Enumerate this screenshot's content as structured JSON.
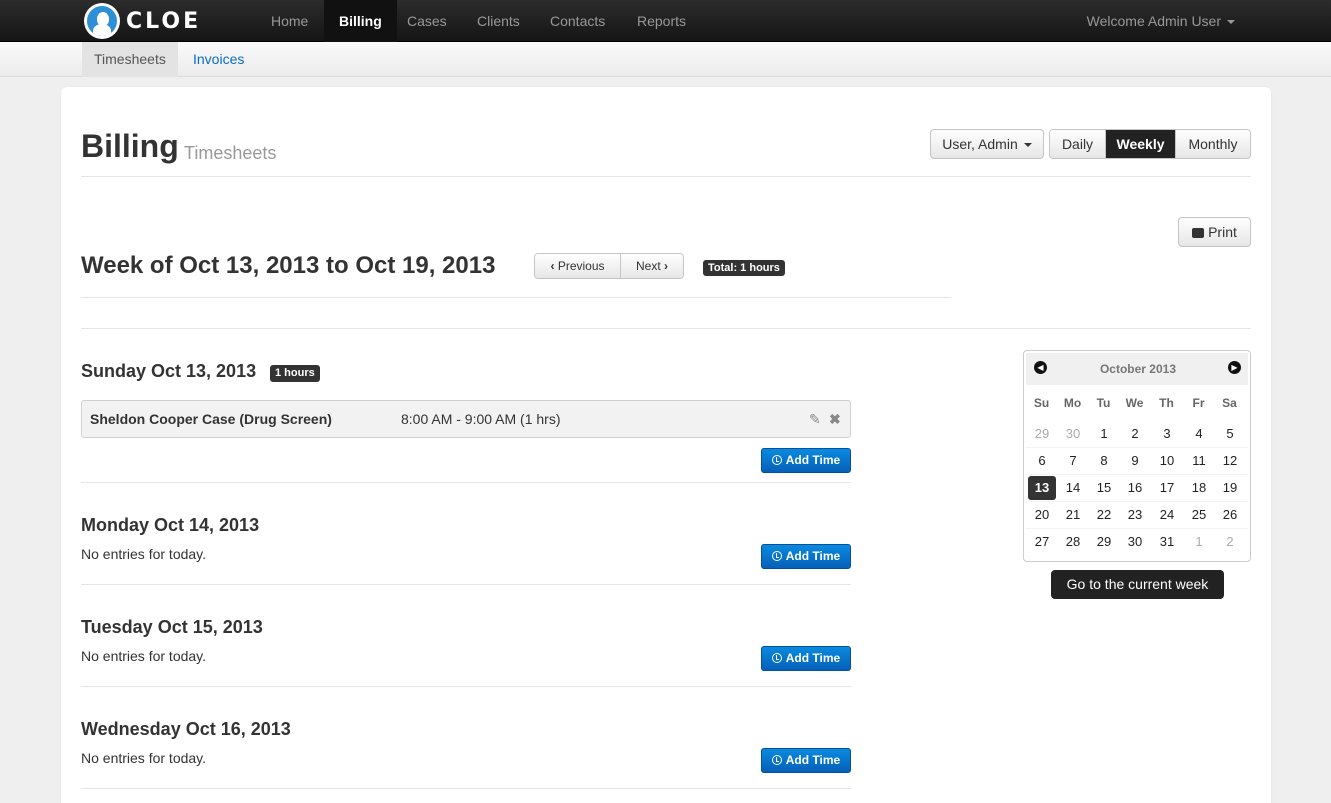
{
  "nav": {
    "logo_text": "CLOE",
    "items": [
      "Home",
      "Billing",
      "Cases",
      "Clients",
      "Contacts",
      "Reports"
    ],
    "active": "Billing",
    "welcome": "Welcome Admin User"
  },
  "subnav": {
    "items": [
      "Timesheets",
      "Invoices"
    ],
    "active": "Timesheets"
  },
  "header": {
    "title": "Billing",
    "subtitle": "Timesheets",
    "user_select": "User, Admin",
    "views": [
      "Daily",
      "Weekly",
      "Monthly"
    ],
    "active_view": "Weekly",
    "print_label": "Print"
  },
  "week": {
    "title": "Week of Oct 13, 2013 to Oct 19, 2013",
    "previous_label": "Previous",
    "next_label": "Next",
    "total_badge": "Total: 1 hours"
  },
  "days": [
    {
      "title": "Sunday Oct 13, 2013",
      "badge": "1 hours",
      "entries": [
        {
          "case": "Sheldon Cooper Case  (Drug Screen)",
          "time": "8:00 AM - 9:00 AM (1 hrs)"
        }
      ],
      "add_label": "Add Time"
    },
    {
      "title": "Monday Oct 14, 2013",
      "empty_text": "No entries for today.",
      "add_label": "Add Time"
    },
    {
      "title": "Tuesday Oct 15, 2013",
      "empty_text": "No entries for today.",
      "add_label": "Add Time"
    },
    {
      "title": "Wednesday Oct 16, 2013",
      "empty_text": "No entries for today.",
      "add_label": "Add Time"
    }
  ],
  "calendar": {
    "month": "October 2013",
    "dow": [
      "Su",
      "Mo",
      "Tu",
      "We",
      "Th",
      "Fr",
      "Sa"
    ],
    "weeks": [
      [
        "29",
        "30",
        "1",
        "2",
        "3",
        "4",
        "5"
      ],
      [
        "6",
        "7",
        "8",
        "9",
        "10",
        "11",
        "12"
      ],
      [
        "13",
        "14",
        "15",
        "16",
        "17",
        "18",
        "19"
      ],
      [
        "20",
        "21",
        "22",
        "23",
        "24",
        "25",
        "26"
      ],
      [
        "27",
        "28",
        "29",
        "30",
        "31",
        "1",
        "2"
      ]
    ],
    "selected": "13",
    "current_week_label": "Go to the current week"
  },
  "colors": {
    "primary": "#0a6cc0",
    "navbar": "#1b1b1b",
    "badge": "#333333"
  }
}
